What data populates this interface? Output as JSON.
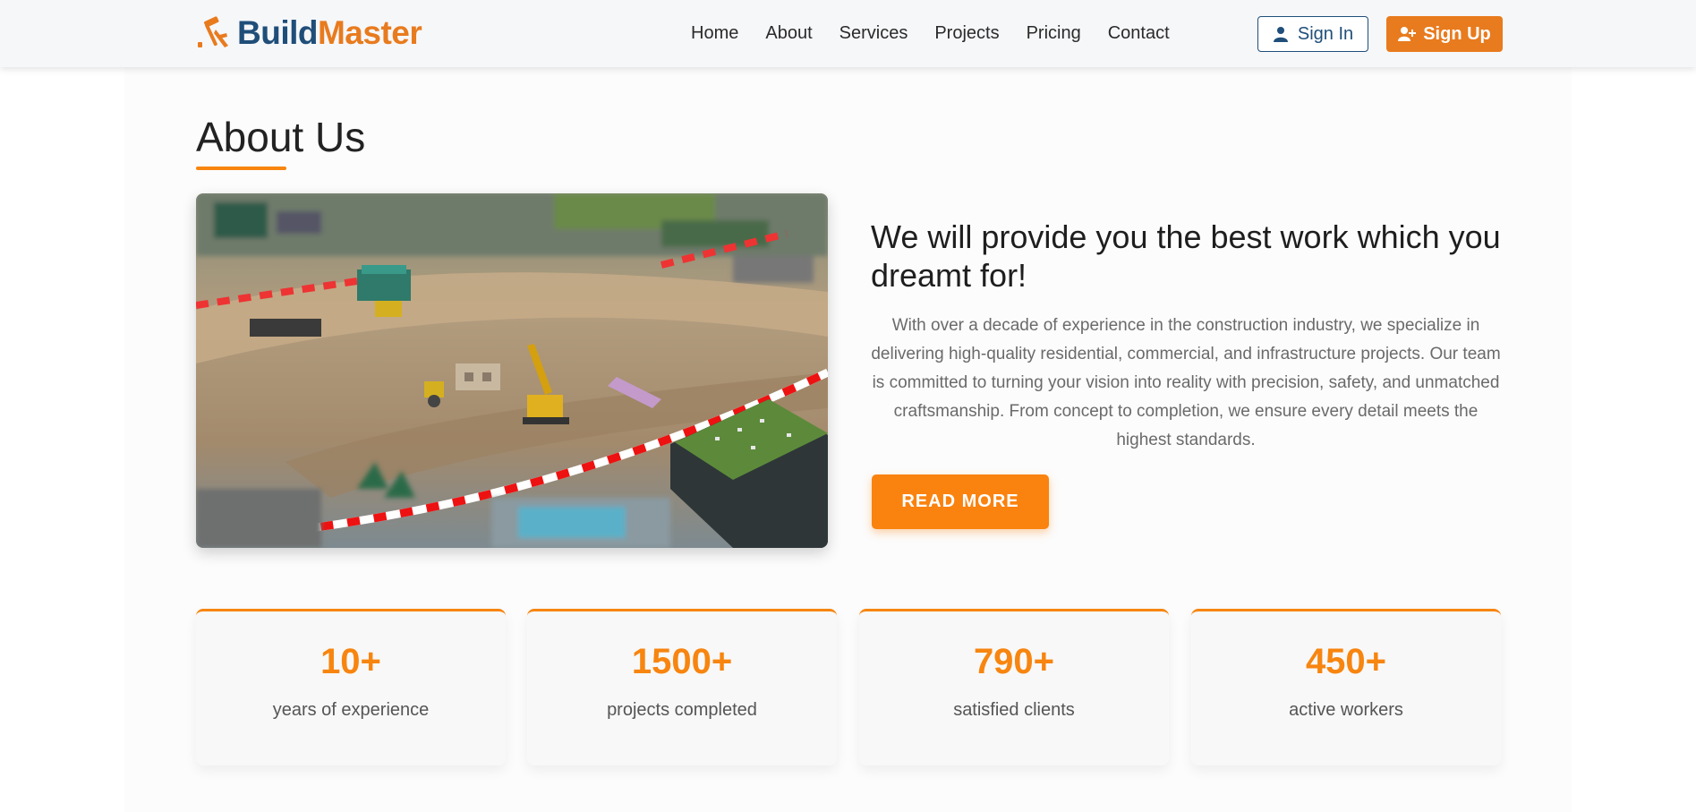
{
  "brand": {
    "name_part1": "Build",
    "name_part2": "Master",
    "logo_icon": "hammer-icon",
    "colors": {
      "primary": "#1f4e79",
      "accent": "#e87b1e"
    }
  },
  "nav": {
    "items": [
      {
        "label": "Home"
      },
      {
        "label": "About"
      },
      {
        "label": "Services"
      },
      {
        "label": "Projects"
      },
      {
        "label": "Pricing"
      },
      {
        "label": "Contact"
      }
    ]
  },
  "auth": {
    "signin_label": "Sign In",
    "signin_icon": "user-icon",
    "signup_label": "Sign Up",
    "signup_icon": "user-plus-icon"
  },
  "about": {
    "title": "About Us",
    "heading": "We will provide you the best work which you dreamt for!",
    "paragraph": "With over a decade of experience in the construction industry, we specialize in delivering high-quality residential, commercial, and infrastructure projects. Our team is committed to turning your vision into reality with precision, safety, and unmatched craftsmanship. From concept to completion, we ensure every detail meets the highest standards.",
    "read_more_label": "READ MORE"
  },
  "stats": [
    {
      "value": "10+",
      "label": "years of experience"
    },
    {
      "value": "1500+",
      "label": "projects completed"
    },
    {
      "value": "790+",
      "label": "satisfied clients"
    },
    {
      "value": "450+",
      "label": "active workers"
    }
  ]
}
